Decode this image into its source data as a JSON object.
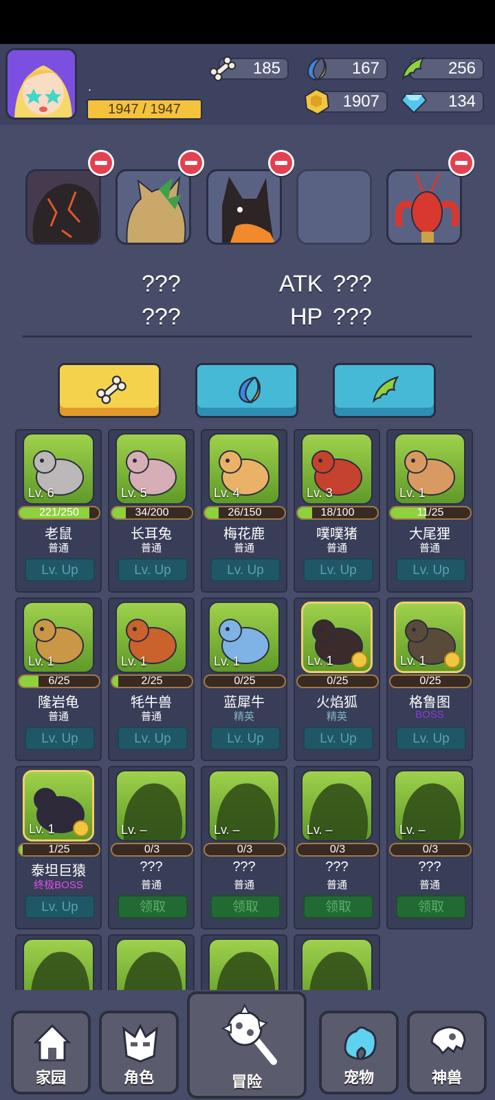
{
  "player": {
    "name": ".",
    "xp": "1947 / 1947"
  },
  "currencies": {
    "bone": "185",
    "crescent": "167",
    "leaf": "256",
    "gold": "1907",
    "gem": "134"
  },
  "stats": {
    "left1": "???",
    "left2": "???",
    "atk_label": "ATK",
    "atk_value": "???",
    "hp_label": "HP",
    "hp_value": "???"
  },
  "tabs": [
    "bone",
    "crescent",
    "leaf"
  ],
  "pets": [
    {
      "lv": "Lv. 6",
      "progress": "221/250",
      "fill": 0.88,
      "name": "老鼠",
      "rarity": "普通",
      "rarity_color": "#ffffff",
      "action": "Lv. Up",
      "type": "lv",
      "color": "#bcb8b8"
    },
    {
      "lv": "Lv. 5",
      "progress": "34/200",
      "fill": 0.17,
      "name": "长耳兔",
      "rarity": "普通",
      "rarity_color": "#ffffff",
      "action": "Lv. Up",
      "type": "lv",
      "color": "#d6aeb6"
    },
    {
      "lv": "Lv. 4",
      "progress": "26/150",
      "fill": 0.17,
      "name": "梅花鹿",
      "rarity": "普通",
      "rarity_color": "#ffffff",
      "action": "Lv. Up",
      "type": "lv",
      "color": "#eab267"
    },
    {
      "lv": "Lv. 3",
      "progress": "18/100",
      "fill": 0.18,
      "name": "噗噗猪",
      "rarity": "普通",
      "rarity_color": "#ffffff",
      "action": "Lv. Up",
      "type": "lv",
      "color": "#c7422e"
    },
    {
      "lv": "Lv. 1",
      "progress": "11/25",
      "fill": 0.44,
      "name": "大尾狸",
      "rarity": "普通",
      "rarity_color": "#ffffff",
      "action": "Lv. Up",
      "type": "lv",
      "color": "#d99a61"
    },
    {
      "lv": "Lv. 1",
      "progress": "6/25",
      "fill": 0.24,
      "name": "隆岩龟",
      "rarity": "普通",
      "rarity_color": "#ffffff",
      "action": "Lv. Up",
      "type": "lv",
      "color": "#c99745"
    },
    {
      "lv": "Lv. 1",
      "progress": "2/25",
      "fill": 0.08,
      "name": "牦牛兽",
      "rarity": "普通",
      "rarity_color": "#ffffff",
      "action": "Lv. Up",
      "type": "lv",
      "color": "#c9622c"
    },
    {
      "lv": "Lv. 1",
      "progress": "0/25",
      "fill": 0,
      "name": "蓝犀牛",
      "rarity": "精英",
      "rarity_color": "#7fb6c4",
      "action": "Lv. Up",
      "type": "lv",
      "color": "#7fb3e6"
    },
    {
      "lv": "Lv. 1",
      "progress": "0/25",
      "fill": 0,
      "name": "火焰狐",
      "rarity": "精英",
      "rarity_color": "#7fb6c4",
      "action": "Lv. Up",
      "type": "lv",
      "color": "#3b2b2b",
      "gold": true
    },
    {
      "lv": "Lv. 1",
      "progress": "0/25",
      "fill": 0,
      "name": "格鲁图",
      "rarity": "BOSS",
      "rarity_color": "#8a3be0",
      "action": "Lv. Up",
      "type": "lv",
      "color": "#5a4a3a",
      "gold": true
    },
    {
      "lv": "Lv. 1",
      "progress": "1/25",
      "fill": 0.04,
      "name": "泰坦巨猿",
      "rarity": "终极BOSS",
      "rarity_color": "#e04fe6",
      "action": "Lv. Up",
      "type": "lv",
      "color": "#2e2a3a",
      "gold": true
    },
    {
      "lv": "Lv. –",
      "progress": "0/3",
      "fill": 0,
      "name": "???",
      "rarity": "普通",
      "rarity_color": "#ffffff",
      "action": "领取",
      "type": "get",
      "color": "#2e4a18",
      "shadow": true
    },
    {
      "lv": "Lv. –",
      "progress": "0/3",
      "fill": 0,
      "name": "???",
      "rarity": "普通",
      "rarity_color": "#ffffff",
      "action": "领取",
      "type": "get",
      "color": "#2e4a18",
      "shadow": true
    },
    {
      "lv": "Lv. –",
      "progress": "0/3",
      "fill": 0,
      "name": "???",
      "rarity": "普通",
      "rarity_color": "#ffffff",
      "action": "领取",
      "type": "get",
      "color": "#2e4a18",
      "shadow": true
    },
    {
      "lv": "Lv. –",
      "progress": "0/3",
      "fill": 0,
      "name": "???",
      "rarity": "普通",
      "rarity_color": "#ffffff",
      "action": "领取",
      "type": "get",
      "color": "#2e4a18",
      "shadow": true
    },
    {
      "lv": "",
      "progress": "",
      "fill": 0,
      "name": "",
      "rarity": "",
      "rarity_color": "#ffffff",
      "action": "",
      "type": "get",
      "color": "#2e4a18",
      "shadow": true
    },
    {
      "lv": "",
      "progress": "",
      "fill": 0,
      "name": "",
      "rarity": "",
      "rarity_color": "#ffffff",
      "action": "",
      "type": "get",
      "color": "#2e4a18",
      "shadow": true
    },
    {
      "lv": "",
      "progress": "",
      "fill": 0,
      "name": "",
      "rarity": "",
      "rarity_color": "#ffffff",
      "action": "",
      "type": "get",
      "color": "#2e4a18",
      "shadow": true
    },
    {
      "lv": "",
      "progress": "",
      "fill": 0,
      "name": "",
      "rarity": "",
      "rarity_color": "#ffffff",
      "action": "",
      "type": "get",
      "color": "#2e4a18",
      "shadow": true
    }
  ],
  "nav": {
    "home": "家园",
    "role": "角色",
    "adventure": "冒险",
    "pet": "宠物",
    "beast": "神兽"
  }
}
